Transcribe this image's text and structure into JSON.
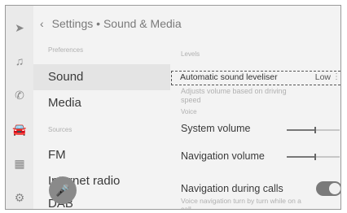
{
  "header": {
    "back_icon": "‹",
    "title": "Settings • Sound & Media"
  },
  "rail": [
    {
      "icon": "navigation-icon",
      "glyph": "➤"
    },
    {
      "icon": "music-icon",
      "glyph": "♫"
    },
    {
      "icon": "phone-icon",
      "glyph": "✆"
    },
    {
      "icon": "car-icon",
      "glyph": "🚘"
    },
    {
      "icon": "apps-icon",
      "glyph": "▦"
    },
    {
      "icon": "settings-icon",
      "glyph": "⚙"
    }
  ],
  "left": {
    "preferences_heading": "Preferences",
    "sound": "Sound",
    "media": "Media",
    "sources_heading": "Sources",
    "fm": "FM",
    "internet_radio": "Internet radio",
    "dab": "DAB"
  },
  "right": {
    "levels_heading": "Levels",
    "automatic_sound_leveliser": "Automatic sound leveliser",
    "asl_value": "Low",
    "asl_more": "⋮",
    "asl_description": "Adjusts volume based on driving speed",
    "voice_heading": "Voice",
    "system_volume": "System volume",
    "system_volume_level": 0.52,
    "navigation_volume": "Navigation volume",
    "navigation_volume_level": 0.52,
    "navigation_during_calls": "Navigation during calls",
    "navigation_during_calls_on": true,
    "navigation_during_calls_desc": "Voice navigation turn by turn while on a call."
  },
  "mic_icon": "microphone-icon"
}
